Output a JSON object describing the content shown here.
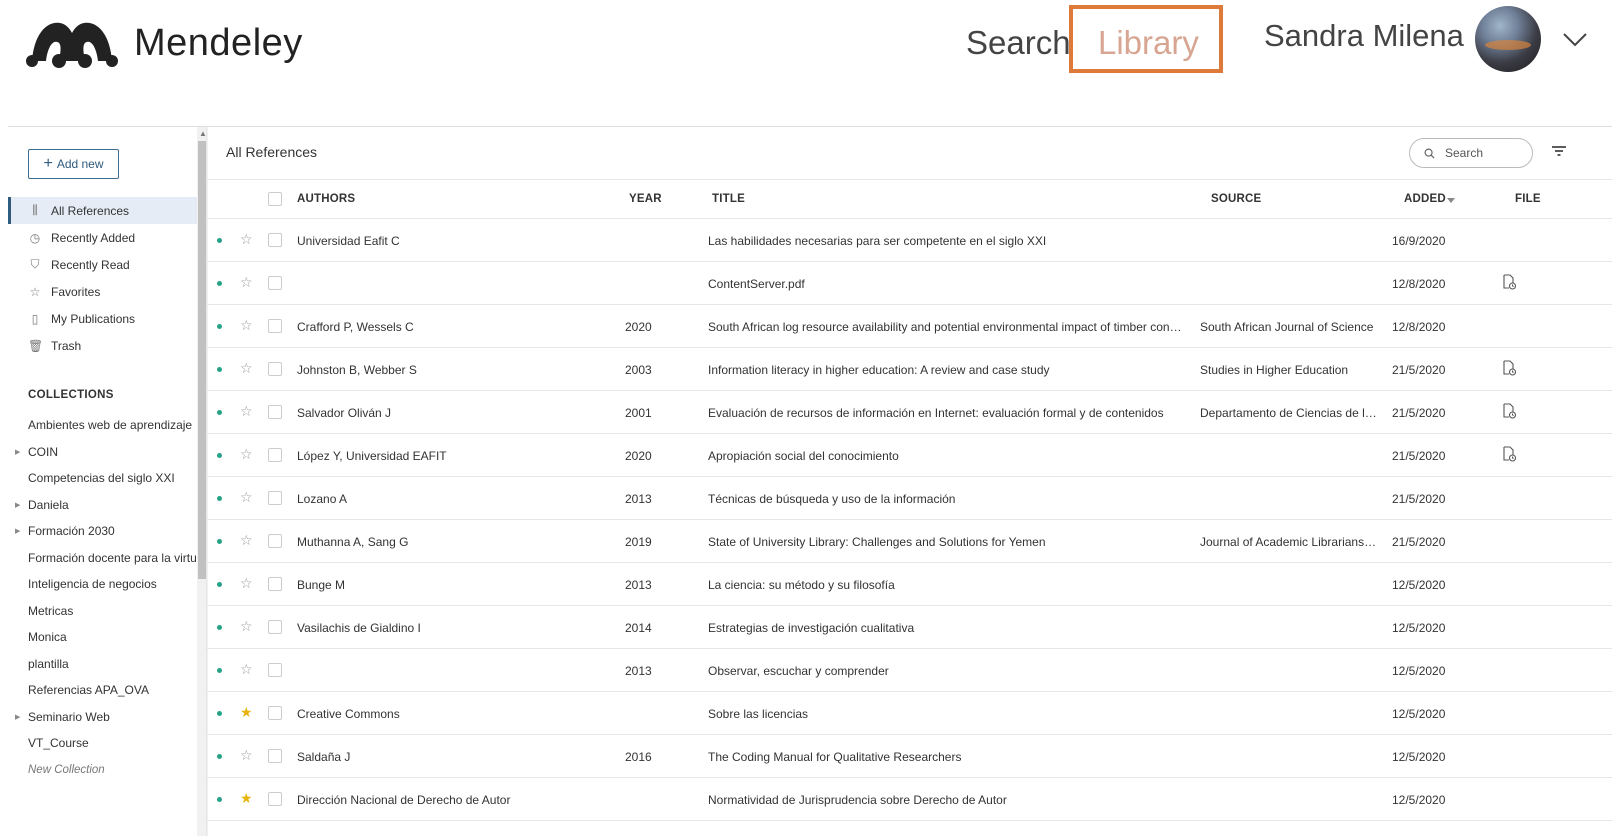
{
  "header": {
    "brand": "Mendeley",
    "nav_search": "Search",
    "nav_library": "Library",
    "user_name": "Sandra Milena"
  },
  "sidebar": {
    "add_new_label": "Add new",
    "items": [
      {
        "label": "All References",
        "icon": "library-icon",
        "glyph": "⫼",
        "active": true
      },
      {
        "label": "Recently Added",
        "icon": "clock-icon",
        "glyph": "◷",
        "active": false
      },
      {
        "label": "Recently Read",
        "icon": "bookmark-icon",
        "glyph": "⛉",
        "active": false
      },
      {
        "label": "Favorites",
        "icon": "star-icon",
        "glyph": "☆",
        "active": false
      },
      {
        "label": "My Publications",
        "icon": "document-icon",
        "glyph": "▯",
        "active": false
      },
      {
        "label": "Trash",
        "icon": "trash-icon",
        "glyph": "🗑",
        "active": false
      }
    ],
    "collections_title": "COLLECTIONS",
    "collections": [
      {
        "label": "Ambientes web de aprendizaje",
        "expandable": false
      },
      {
        "label": "COIN",
        "expandable": true
      },
      {
        "label": "Competencias del siglo XXI",
        "expandable": false
      },
      {
        "label": "Daniela",
        "expandable": true
      },
      {
        "label": "Formación 2030",
        "expandable": true
      },
      {
        "label": "Formación docente para la virtualidad",
        "expandable": false
      },
      {
        "label": "Inteligencia de negocios",
        "expandable": false
      },
      {
        "label": "Metricas",
        "expandable": false
      },
      {
        "label": "Monica",
        "expandable": false
      },
      {
        "label": "plantilla",
        "expandable": false
      },
      {
        "label": "Referencias APA_OVA",
        "expandable": false
      },
      {
        "label": "Seminario Web",
        "expandable": true
      },
      {
        "label": "VT_Course",
        "expandable": false
      }
    ],
    "new_collection_label": "New Collection"
  },
  "main": {
    "title": "All References",
    "search_placeholder": "Search",
    "columns": {
      "authors": "AUTHORS",
      "year": "YEAR",
      "title": "TITLE",
      "source": "SOURCE",
      "added": "ADDED",
      "file": "FILE"
    },
    "rows": [
      {
        "authors": "Universidad Eafit C",
        "year": "",
        "title": "Las habilidades necesarias para ser competente en el siglo XXI",
        "source": "",
        "added": "16/9/2020",
        "file": false,
        "favorite": false
      },
      {
        "authors": "",
        "year": "",
        "title": "ContentServer.pdf",
        "source": "",
        "added": "12/8/2020",
        "file": true,
        "favorite": false
      },
      {
        "authors": "Crafford P, Wessels C",
        "year": "2020",
        "title": "South African log resource availability and potential environmental impact of timber construction",
        "source": "South African Journal of Science",
        "added": "12/8/2020",
        "file": false,
        "favorite": false
      },
      {
        "authors": "Johnston B, Webber S",
        "year": "2003",
        "title": "Information literacy in higher education: A review and case study",
        "source": "Studies in Higher Education",
        "added": "21/5/2020",
        "file": true,
        "favorite": false
      },
      {
        "authors": "Salvador Oliván J",
        "year": "2001",
        "title": "Evaluación de recursos de información en Internet: evaluación formal y de contenidos",
        "source": "Departamento de Ciencias de la Documentación",
        "added": "21/5/2020",
        "file": true,
        "favorite": false
      },
      {
        "authors": "López Y, Universidad EAFIT",
        "year": "2020",
        "title": "Apropiación social del conocimiento",
        "source": "",
        "added": "21/5/2020",
        "file": true,
        "favorite": false
      },
      {
        "authors": "Lozano A",
        "year": "2013",
        "title": "Técnicas de búsqueda y uso de la información",
        "source": "",
        "added": "21/5/2020",
        "file": false,
        "favorite": false
      },
      {
        "authors": "Muthanna A, Sang G",
        "year": "2019",
        "title": "State of University Library: Challenges and Solutions for Yemen",
        "source": "Journal of Academic Librarianship",
        "added": "21/5/2020",
        "file": false,
        "favorite": false
      },
      {
        "authors": "Bunge M",
        "year": "2013",
        "title": "La ciencia: su método y su filosofía",
        "source": "",
        "added": "12/5/2020",
        "file": false,
        "favorite": false
      },
      {
        "authors": "Vasilachis de Gialdino I",
        "year": "2014",
        "title": "Estrategias de investigación cualitativa",
        "source": "",
        "added": "12/5/2020",
        "file": false,
        "favorite": false
      },
      {
        "authors": "",
        "year": "2013",
        "title": "Observar, escuchar y comprender",
        "source": "",
        "added": "12/5/2020",
        "file": false,
        "favorite": false
      },
      {
        "authors": "Creative Commons",
        "year": "",
        "title": "Sobre las licencias",
        "source": "",
        "added": "12/5/2020",
        "file": false,
        "favorite": true
      },
      {
        "authors": "Saldaña J",
        "year": "2016",
        "title": "The Coding Manual for Qualitative Researchers",
        "source": "",
        "added": "12/5/2020",
        "file": false,
        "favorite": false
      },
      {
        "authors": "Dirección Nacional de Derecho de Autor",
        "year": "",
        "title": "Normatividad de Jurisprudencia sobre Derecho de Autor",
        "source": "",
        "added": "12/5/2020",
        "file": false,
        "favorite": true
      }
    ]
  },
  "colors": {
    "accent": "#2f5b7d",
    "library_highlight": "#dd7a39",
    "unread_dot": "#26a387",
    "favorite_star": "#e8b40c"
  }
}
